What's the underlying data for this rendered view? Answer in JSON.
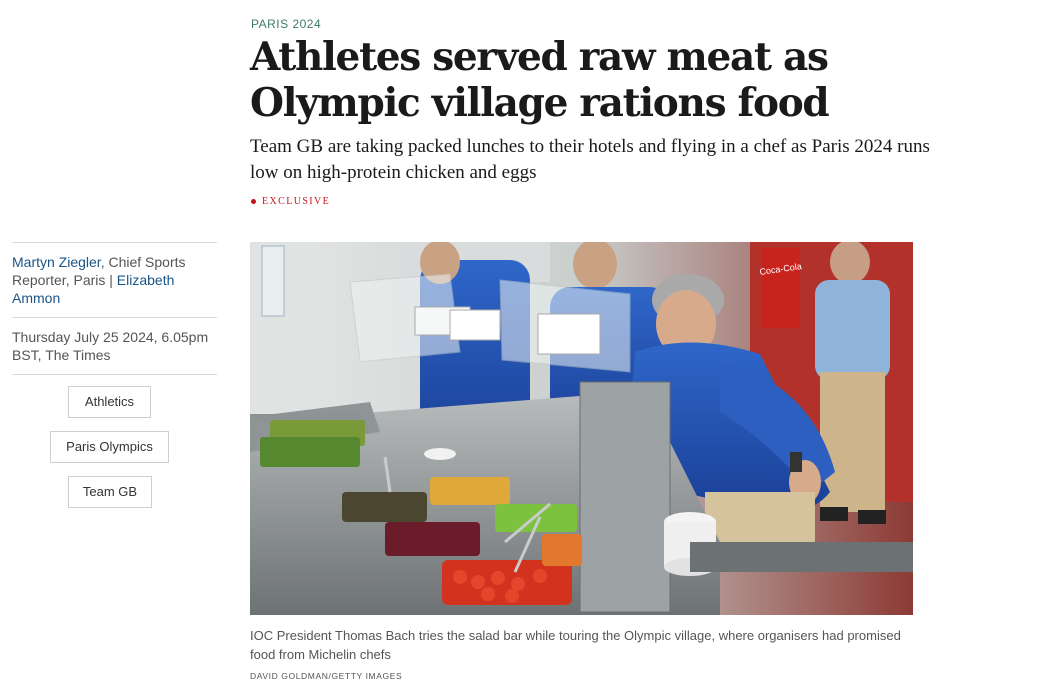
{
  "article": {
    "kicker": "PARIS 2024",
    "headline": "Athletes served raw meat as Olympic village rations food",
    "standfirst": "Team GB are taking packed lunches to their hotels and flying in a chef as Paris 2024 runs low on high-protein chicken and eggs",
    "label": "EXCLUSIVE"
  },
  "byline": {
    "author1": "Martyn Ziegler",
    "author1_role": ", Chief Sports Reporter, Paris | ",
    "author2": "Elizabeth Ammon"
  },
  "date": "Thursday July 25 2024, 6.05pm BST, The Times",
  "tags": [
    "Athletics",
    "Paris Olympics",
    "Team GB"
  ],
  "image": {
    "caption": "IOC President Thomas Bach tries the salad bar while touring the Olympic village, where organisers had promised food from Michelin chefs",
    "credit": "DAVID GOLDMAN/GETTY IMAGES",
    "sign_text": "Coca-Cola"
  },
  "colors": {
    "kicker": "#3e7e63",
    "exclusive": "#c4151c",
    "link": "#1a5587"
  }
}
